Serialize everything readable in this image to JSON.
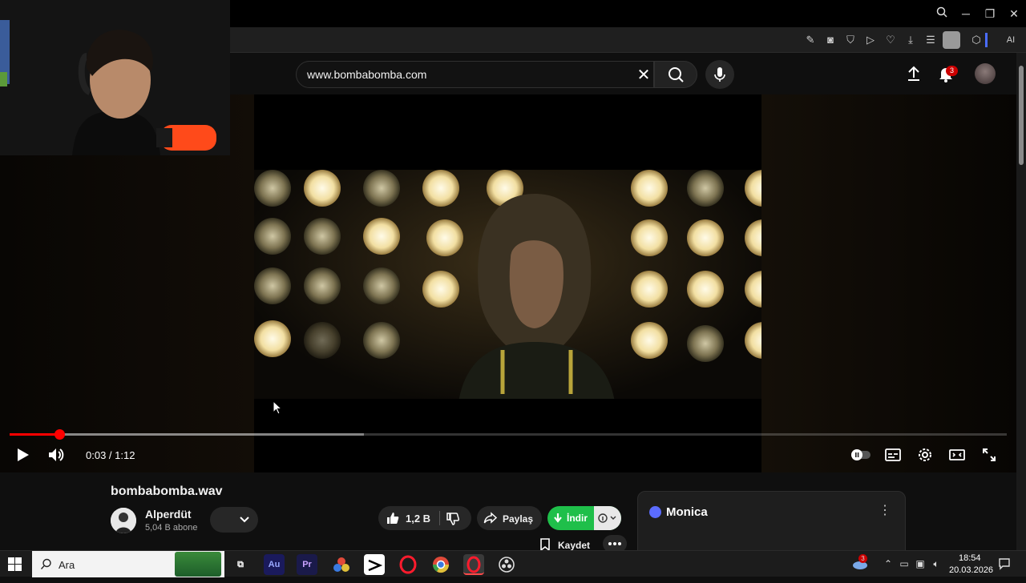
{
  "browser": {
    "window_controls": {
      "search": "search-icon",
      "minimize": "─",
      "restore": "❐",
      "close": "✕"
    },
    "ai_label": "AI"
  },
  "search": {
    "value": "www.bombabomba.com",
    "placeholder": "Ara"
  },
  "notifications": {
    "count": "3"
  },
  "player": {
    "time": "0:03 / 1:12",
    "progress_fraction": 0.05,
    "buffer_fraction": 0.355
  },
  "video": {
    "title": "bombabomba.wav",
    "channel": {
      "name": "Alperdüt",
      "subscribers": "5,04 B abone"
    },
    "likes": "1,2 B",
    "share_label": "Paylaş",
    "download_label": "İndir",
    "save_label": "Kaydet"
  },
  "monica": {
    "title": "Monica"
  },
  "taskbar": {
    "search_label": "Ara",
    "apps": [
      "Au",
      "Pr"
    ],
    "weather_badge": "3",
    "clock_time": "18:54",
    "clock_date": "20.03.2026"
  },
  "colors": {
    "accent_red": "#ff0000",
    "download_green": "#1fbf4a",
    "background": "#0f0f0f"
  }
}
